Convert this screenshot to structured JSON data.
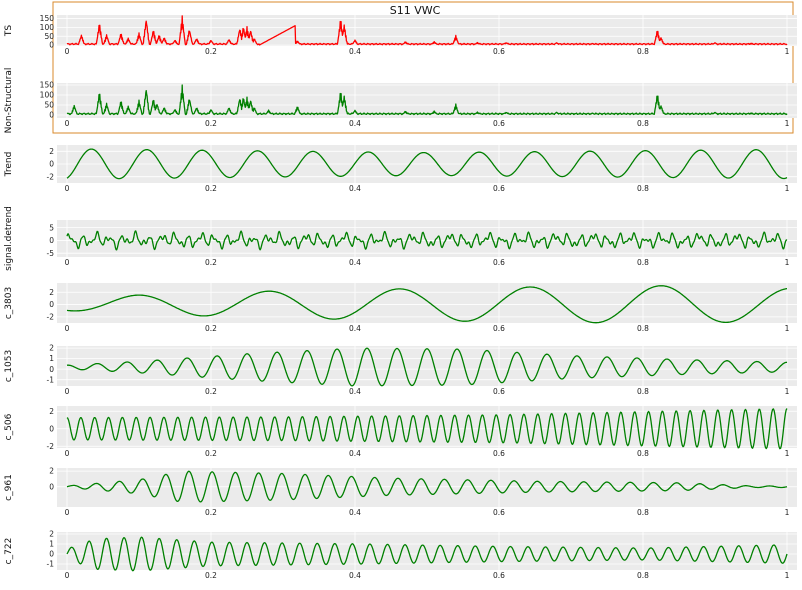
{
  "figure": {
    "title": "S11 VWC",
    "colors": {
      "ts": "#ff0000",
      "green": "#008000",
      "panel_bg": "#ebebeb",
      "grid": "#ffffff",
      "box": "#d98a2b"
    }
  },
  "chart_data": [
    {
      "type": "line",
      "name": "ts",
      "ylabel": "TS",
      "xlim": [
        0.0,
        1.0
      ],
      "xticks": [
        0.0,
        0.2,
        0.4,
        0.6,
        0.8,
        1.0
      ],
      "ylim": [
        -5,
        170
      ],
      "yticks": [
        0,
        50,
        100,
        150
      ],
      "series": [
        {
          "color": "#ff0000",
          "kind": "spiky",
          "x_range": [
            0.0,
            1.0
          ],
          "baseline": 6,
          "spikes": [
            [
              0.02,
              60
            ],
            [
              0.045,
              130
            ],
            [
              0.055,
              60
            ],
            [
              0.075,
              70
            ],
            [
              0.085,
              40
            ],
            [
              0.1,
              70
            ],
            [
              0.11,
              155
            ],
            [
              0.12,
              90
            ],
            [
              0.128,
              60
            ],
            [
              0.135,
              45
            ],
            [
              0.15,
              30
            ],
            [
              0.16,
              165
            ],
            [
              0.17,
              95
            ],
            [
              0.18,
              40
            ],
            [
              0.2,
              30
            ],
            [
              0.225,
              35
            ],
            [
              0.24,
              100
            ],
            [
              0.245,
              110
            ],
            [
              0.25,
              105
            ],
            [
              0.255,
              90
            ],
            [
              0.26,
              40
            ],
            [
              0.28,
              30
            ],
            [
              0.32,
              25
            ],
            [
              0.38,
              155
            ],
            [
              0.385,
              120
            ],
            [
              0.4,
              30
            ],
            [
              0.47,
              20
            ],
            [
              0.51,
              20
            ],
            [
              0.54,
              55
            ],
            [
              0.57,
              15
            ],
            [
              0.61,
              15
            ],
            [
              0.68,
              15
            ],
            [
              0.73,
              10
            ],
            [
              0.82,
              90
            ],
            [
              0.825,
              45
            ],
            [
              0.9,
              15
            ],
            [
              0.95,
              10
            ]
          ],
          "gap": [
            0.267,
            0.317,
            0.0,
            110
          ]
        }
      ]
    },
    {
      "type": "line",
      "name": "non_structural",
      "ylabel": "Non-Structural",
      "xlim": [
        0.0,
        1.0
      ],
      "xticks": [
        0.0,
        0.2,
        0.4,
        0.6,
        0.8,
        1.0
      ],
      "ylim": [
        -15,
        160
      ],
      "yticks": [
        0,
        50,
        100,
        150
      ],
      "series": [
        {
          "color": "#008000",
          "kind": "spiky",
          "x_range": [
            0.0,
            1.0
          ],
          "baseline": 6,
          "spikes": [
            [
              0.01,
              50
            ],
            [
              0.045,
              120
            ],
            [
              0.055,
              60
            ],
            [
              0.075,
              75
            ],
            [
              0.085,
              45
            ],
            [
              0.1,
              75
            ],
            [
              0.11,
              140
            ],
            [
              0.12,
              85
            ],
            [
              0.125,
              60
            ],
            [
              0.135,
              40
            ],
            [
              0.15,
              30
            ],
            [
              0.16,
              150
            ],
            [
              0.17,
              90
            ],
            [
              0.18,
              40
            ],
            [
              0.2,
              30
            ],
            [
              0.225,
              40
            ],
            [
              0.24,
              90
            ],
            [
              0.245,
              95
            ],
            [
              0.25,
              90
            ],
            [
              0.255,
              80
            ],
            [
              0.26,
              40
            ],
            [
              0.28,
              25
            ],
            [
              0.32,
              45
            ],
            [
              0.38,
              125
            ],
            [
              0.385,
              100
            ],
            [
              0.4,
              25
            ],
            [
              0.47,
              20
            ],
            [
              0.51,
              20
            ],
            [
              0.54,
              55
            ],
            [
              0.57,
              15
            ],
            [
              0.61,
              15
            ],
            [
              0.68,
              15
            ],
            [
              0.73,
              10
            ],
            [
              0.82,
              110
            ],
            [
              0.825,
              50
            ],
            [
              0.9,
              15
            ],
            [
              0.95,
              10
            ]
          ]
        }
      ]
    },
    {
      "type": "line",
      "name": "trend",
      "ylabel": "Trend",
      "xlim": [
        0.0,
        1.0
      ],
      "xticks": [
        0.0,
        0.2,
        0.4,
        0.6,
        0.8,
        1.0
      ],
      "ylim": [
        -3,
        3
      ],
      "yticks": [
        -2,
        0,
        2
      ],
      "series": [
        {
          "color": "#008000",
          "kind": "wave",
          "x_range": [
            0.0,
            1.0
          ],
          "amplitude": 2.0,
          "cycles": 13.0,
          "phase": -1.2,
          "env": [
            [
              0.0,
              1.2
            ],
            [
              0.5,
              0.9
            ],
            [
              1.0,
              1.15
            ]
          ]
        }
      ]
    },
    {
      "type": "line",
      "name": "signal_detrend",
      "ylabel": "signal.detrend",
      "xlim": [
        0.0,
        1.0
      ],
      "xticks": [
        0.0,
        0.2,
        0.4,
        0.6,
        0.8,
        1.0
      ],
      "ylim": [
        -6.5,
        8
      ],
      "yticks": [
        -5,
        0,
        5
      ],
      "series": [
        {
          "color": "#008000",
          "kind": "noise",
          "x_range": [
            0.0,
            1.0
          ],
          "amplitude": 3.5,
          "cycles": 55
        }
      ]
    },
    {
      "type": "line",
      "name": "c_3803",
      "ylabel": "c_3803",
      "xlim": [
        0.0,
        1.0
      ],
      "xticks": [
        0.0,
        0.2,
        0.4,
        0.6,
        0.8,
        1.0
      ],
      "ylim": [
        -3,
        3.5
      ],
      "yticks": [
        -2,
        0,
        2
      ],
      "series": [
        {
          "color": "#008000",
          "kind": "wave",
          "x_range": [
            0.0,
            1.0
          ],
          "amplitude": 2.8,
          "cycles": 5.5,
          "phase": -1.8,
          "env": [
            [
              0.0,
              0.35
            ],
            [
              0.1,
              0.55
            ],
            [
              0.3,
              0.8
            ],
            [
              0.6,
              1.0
            ],
            [
              0.85,
              1.1
            ],
            [
              1.0,
              0.95
            ]
          ]
        }
      ]
    },
    {
      "type": "line",
      "name": "c_1053",
      "ylabel": "c_1053",
      "xlim": [
        0.0,
        1.0
      ],
      "xticks": [
        0.0,
        0.2,
        0.4,
        0.6,
        0.8,
        1.0
      ],
      "ylim": [
        -1.6,
        2.2
      ],
      "yticks": [
        -1,
        0,
        1,
        2
      ],
      "series": [
        {
          "color": "#008000",
          "kind": "wave",
          "x_range": [
            0.0,
            1.0
          ],
          "amplitude": 1.8,
          "cycles": 24.0,
          "phase": 1.57,
          "offset": 0.2,
          "env": [
            [
              0.0,
              0.1
            ],
            [
              0.1,
              0.3
            ],
            [
              0.25,
              0.7
            ],
            [
              0.4,
              1.0
            ],
            [
              0.55,
              0.95
            ],
            [
              0.7,
              0.6
            ],
            [
              0.85,
              0.4
            ],
            [
              1.0,
              0.25
            ]
          ]
        }
      ]
    },
    {
      "type": "line",
      "name": "c_506",
      "ylabel": "c_506",
      "xlim": [
        0.0,
        1.0
      ],
      "xticks": [
        0.0,
        0.2,
        0.4,
        0.6,
        0.8,
        1.0
      ],
      "ylim": [
        -2.2,
        2.6
      ],
      "yticks": [
        -2,
        0,
        2
      ],
      "series": [
        {
          "color": "#008000",
          "kind": "wave",
          "x_range": [
            0.0,
            1.0
          ],
          "amplitude": 1.6,
          "cycles": 52.0,
          "phase": 1.57,
          "env": [
            [
              0.0,
              0.8
            ],
            [
              0.3,
              0.85
            ],
            [
              0.6,
              1.0
            ],
            [
              1.0,
              1.45
            ]
          ]
        }
      ]
    },
    {
      "type": "line",
      "name": "c_961",
      "ylabel": "c_961",
      "xlim": [
        0.0,
        1.0
      ],
      "xticks": [
        0.0,
        0.2,
        0.4,
        0.6,
        0.8,
        1.0
      ],
      "ylim": [
        -2.6,
        2.4
      ],
      "yticks": [
        0,
        2
      ],
      "series": [
        {
          "color": "#008000",
          "kind": "wave",
          "x_range": [
            0.0,
            1.0
          ],
          "amplitude": 2.0,
          "cycles": 31.0,
          "phase": 0.0,
          "env": [
            [
              0.0,
              0.05
            ],
            [
              0.1,
              0.45
            ],
            [
              0.16,
              1.0
            ],
            [
              0.3,
              0.85
            ],
            [
              0.45,
              0.55
            ],
            [
              0.65,
              0.35
            ],
            [
              0.85,
              0.25
            ],
            [
              0.95,
              0.05
            ],
            [
              1.0,
              0.05
            ]
          ]
        }
      ]
    },
    {
      "type": "line",
      "name": "c_722",
      "ylabel": "c_722",
      "xlim": [
        0.0,
        1.0
      ],
      "xticks": [
        0.0,
        0.2,
        0.4,
        0.6,
        0.8,
        1.0
      ],
      "ylim": [
        -1.6,
        2.2
      ],
      "yticks": [
        -1,
        0,
        1,
        2
      ],
      "series": [
        {
          "color": "#008000",
          "kind": "wave",
          "x_range": [
            0.0,
            1.0
          ],
          "amplitude": 1.7,
          "cycles": 41.0,
          "phase": 0.0,
          "env": [
            [
              0.0,
              0.3
            ],
            [
              0.04,
              0.9
            ],
            [
              0.1,
              1.0
            ],
            [
              0.2,
              0.7
            ],
            [
              0.4,
              0.6
            ],
            [
              0.6,
              0.45
            ],
            [
              0.8,
              0.35
            ],
            [
              1.0,
              0.55
            ]
          ]
        }
      ]
    }
  ]
}
